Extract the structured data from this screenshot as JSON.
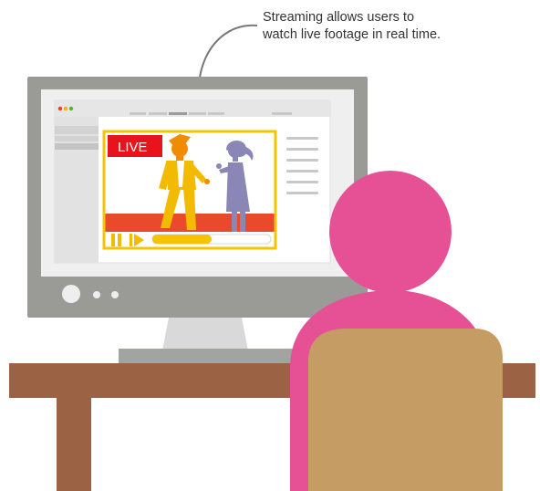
{
  "caption": {
    "line1": "Streaming allows users to",
    "line2": "watch live footage in real time."
  },
  "video": {
    "badge_label": "LIVE",
    "progress": 0.5
  },
  "colors": {
    "monitor_frame": "#9a9a96",
    "monitor_stand": "#d9d9d9",
    "desk": "#9b6244",
    "chair": "#c59c64",
    "person": "#e65196",
    "live_badge": "#e8141b",
    "video_frame": "#f5c400",
    "presenter_yellow": "#f2bb00",
    "presenter_purple": "#8a86b6",
    "video_red_strip": "#e94a2c"
  },
  "icons": {
    "arrow": "curved-arrow-icon",
    "pause": "pause-icon",
    "play": "play-icon"
  }
}
